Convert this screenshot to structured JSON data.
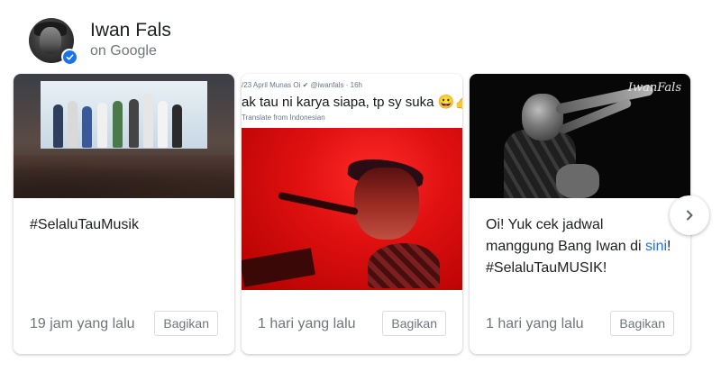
{
  "profile": {
    "name": "Iwan Fals",
    "source": "on Google",
    "verified_icon": "verified-badge-icon"
  },
  "cards": [
    {
      "text": "#SelaluTauMusik",
      "time": "19 jam yang lalu",
      "share_label": "Bagikan"
    },
    {
      "tweet_meta": "/23 April Munas Oi ✔ @iwanfals · 16h",
      "tweet_text": "ak tau ni karya siapa, tp sy suka 😀👍",
      "tweet_translate": "Translate from Indonesian",
      "time": "1 hari yang lalu",
      "share_label": "Bagikan"
    },
    {
      "text_before": "Oi! Yuk cek jadwal manggung Bang Iwan di ",
      "link_text": "sini",
      "text_after": "! #SelaluTauMUSIK!",
      "image_logo": "IwanFals",
      "time": "1 hari yang lalu",
      "share_label": "Bagikan"
    }
  ],
  "carousel": {
    "next_icon": "chevron-right-icon"
  },
  "colors": {
    "link": "#1a73e8",
    "verified": "#1a73e8",
    "muted_text": "#70757a"
  }
}
